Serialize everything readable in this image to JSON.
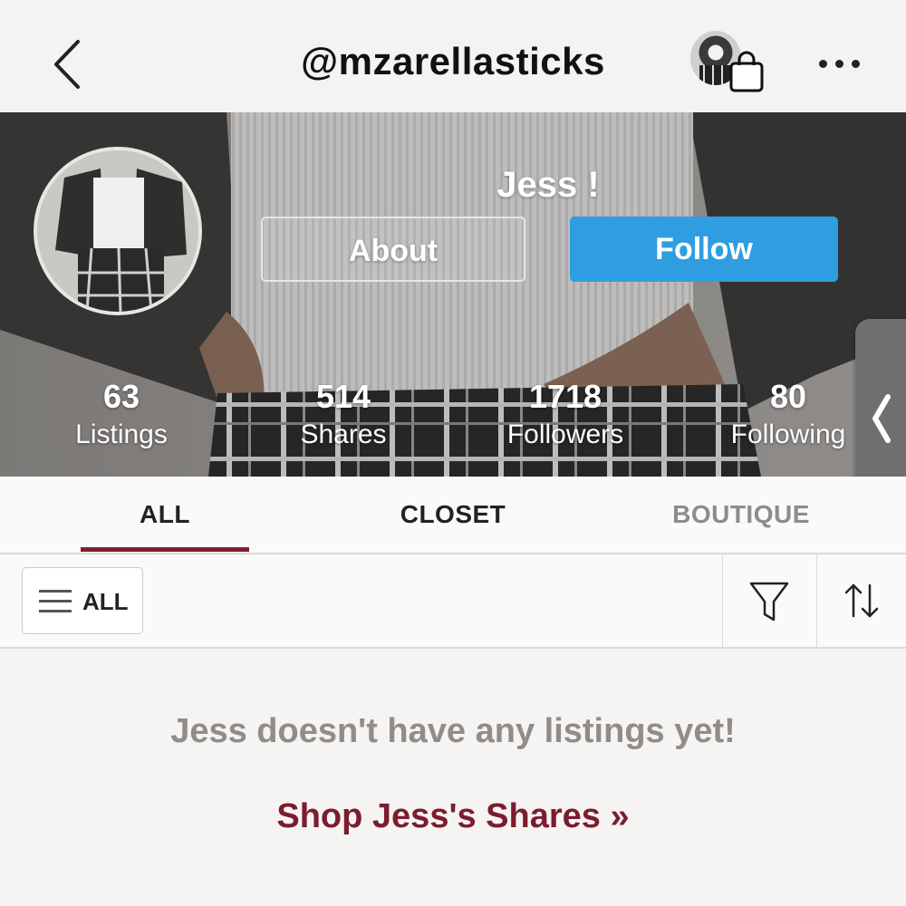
{
  "header": {
    "username": "@mzarellasticks"
  },
  "profile": {
    "display_name": "Jess !",
    "about_label": "About",
    "follow_label": "Follow",
    "follow_color": "#2f9ee0",
    "stats": [
      {
        "value": "63",
        "label": "Listings"
      },
      {
        "value": "514",
        "label": "Shares"
      },
      {
        "value": "1718",
        "label": "Followers"
      },
      {
        "value": "80",
        "label": "Following"
      }
    ]
  },
  "tabs": [
    {
      "label": "ALL",
      "active": true
    },
    {
      "label": "CLOSET",
      "active": false
    },
    {
      "label": "BOUTIQUE",
      "active": false
    }
  ],
  "filter_bar": {
    "all_label": "ALL",
    "icons": [
      "menu-icon",
      "filter-icon",
      "sort-icon"
    ]
  },
  "empty_state": {
    "message": "Jess doesn't have any listings yet!",
    "link": "Shop Jess's Shares »"
  },
  "colors": {
    "accent": "#7b1d2e",
    "tab_underline": "#7f1f2f"
  }
}
